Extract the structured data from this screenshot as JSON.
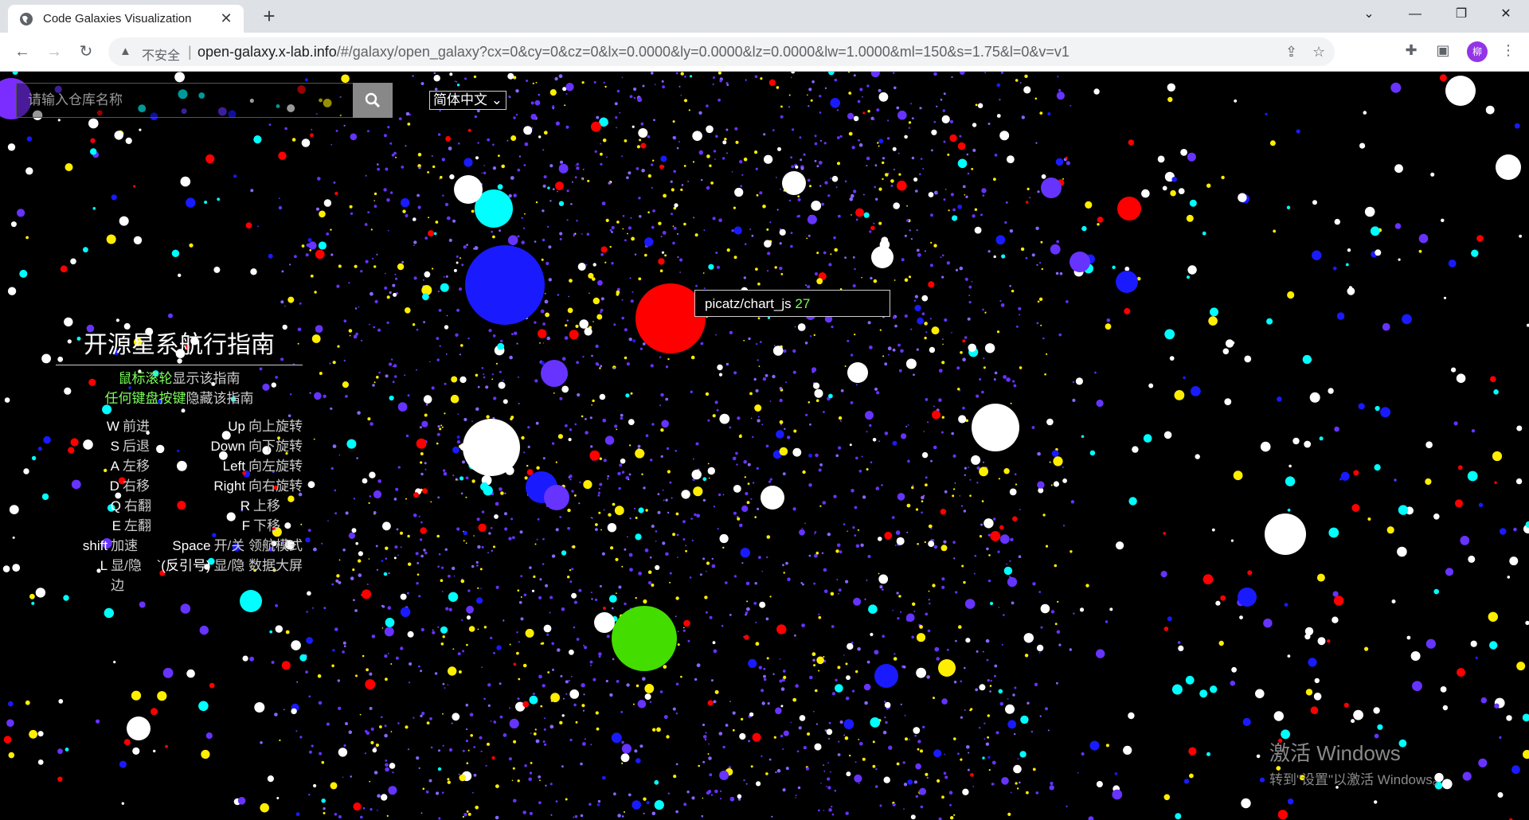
{
  "browser": {
    "tab_title": "Code Galaxies Visualization",
    "tab_close": "✕",
    "new_tab": "+",
    "insecure_label": "不安全",
    "url_host": "open-galaxy.x-lab.info",
    "url_path": "/#/galaxy/open_galaxy?cx=0&cy=0&cz=0&lx=0.0000&ly=0.0000&lz=0.0000&lw=1.0000&ml=150&s=1.75&l=0&v=v1",
    "avatar_initial": "柳"
  },
  "search": {
    "placeholder": "请输入仓库名称",
    "value": ""
  },
  "language": {
    "selected": "简体中文"
  },
  "guide": {
    "title": "开源星系航行指南",
    "hint1_key": "鼠标滚轮",
    "hint1_text": "显示该指南",
    "hint2_key": "任何键盘按键",
    "hint2_text": "隐藏该指南",
    "rows": [
      {
        "k1": "W",
        "d1": "前进",
        "k2": "Up",
        "d2": "向上旋转"
      },
      {
        "k1": "S",
        "d1": "后退",
        "k2": "Down",
        "d2": "向下旋转"
      },
      {
        "k1": "A",
        "d1": "左移",
        "k2": "Left",
        "d2": "向左旋转"
      },
      {
        "k1": "D",
        "d1": "右移",
        "k2": "Right",
        "d2": "向右旋转"
      },
      {
        "k1": "Q",
        "d1": "右翻",
        "k2": "R",
        "d2": "上移"
      },
      {
        "k1": "E",
        "d1": "左翻",
        "k2": "F",
        "d2": "下移"
      },
      {
        "k1": "shift",
        "d1": "加速",
        "k2": "Space",
        "d2": "开/关 领航模式"
      },
      {
        "k1": "L",
        "d1": "显/隐 边",
        "k2": "`(反引号)",
        "d2": "显/隐 数据大屏"
      }
    ]
  },
  "tooltip": {
    "repo": "picatz/chart_js",
    "value": "27"
  },
  "watermark": {
    "line1": "激活 Windows",
    "line2": "转到\"设置\"以激活 Windows。"
  },
  "colors": {
    "node_white": "#ffffff",
    "node_blue": "#1a1aff",
    "node_purple": "#6633ff",
    "node_cyan": "#00ffff",
    "node_red": "#ff0000",
    "node_green": "#44dd00",
    "node_yellow": "#ffee00",
    "highlight_green": "#7cfc5a"
  }
}
